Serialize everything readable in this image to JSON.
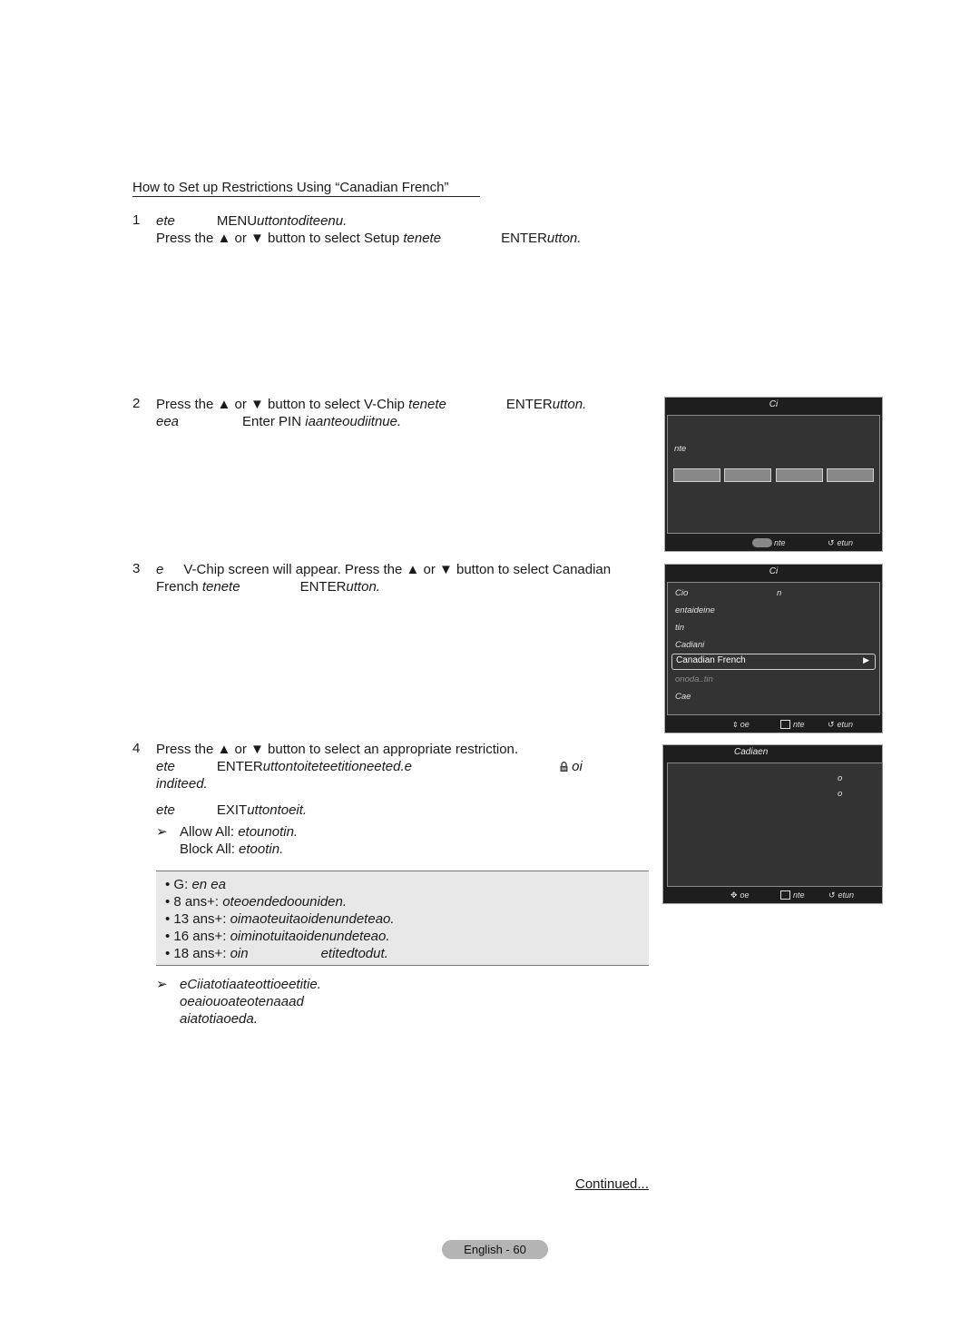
{
  "section": {
    "title": "How to Set up Restrictions Using “Canadian French”"
  },
  "steps": [
    {
      "number": "1",
      "lines": [
        {
          "a": "ete",
          "b": "MENU",
          "c": "uttontoditeenu."
        },
        {
          "a": "Press the ▲ or ▼ button to select Setup",
          "b": "tenete",
          "c": "ENTER",
          "d": "utton."
        }
      ]
    },
    {
      "number": "2",
      "lines": [
        {
          "a": "Press the ▲ or ▼ button to select V-Chip",
          "b": "tenete",
          "c": "ENTER",
          "d": "utton."
        },
        {
          "a": "eea",
          "b": "Enter PIN",
          "c": "iaanteoudiitnue."
        }
      ]
    },
    {
      "number": "3",
      "lines": [
        {
          "a": "e",
          "b": "V-Chip  screen will appear. Press the ▲ or ▼ button to select Canadian"
        },
        {
          "a": "French",
          "b": "tenete",
          "c": "ENTER",
          "d": "utton."
        }
      ]
    },
    {
      "number": "4",
      "lines": [
        {
          "a": "Press the ▲ or ▼ button to select an appropriate restriction."
        },
        {
          "a": "ete",
          "b": "ENTER",
          "c": "uttontoiteteetitioneeted.e",
          "d": "oi"
        },
        {
          "a": "inditeed."
        },
        {
          "a": "ete",
          "b": "EXIT",
          "c": "uttontoeit."
        }
      ],
      "tips": [
        {
          "label": "Allow All:",
          "text": "etounotin."
        },
        {
          "label": "Block All:",
          "text": "etootin."
        }
      ]
    }
  ],
  "ratings_box": [
    {
      "label": "• G:",
      "text": "en   ea"
    },
    {
      "label": "• 8 ans+:",
      "text": "oteoendedoouniden."
    },
    {
      "label": "• 13 ans+:",
      "text": "oimaoteuitaoidenundeteao."
    },
    {
      "label": "• 16 ans+:",
      "text": "oiminotuitaoidenundeteao."
    },
    {
      "label": "• 18 ans+:",
      "text": "oin",
      "text2": "etitedtodut."
    }
  ],
  "note": {
    "lines": [
      "eCiiatotiaateottioeetitie.",
      "oeaiouoateotenaaad",
      "aiatotiaoeda."
    ]
  },
  "tv_screens": {
    "pin": {
      "title": "Ci",
      "label": "nte",
      "footer": {
        "enter": "nte",
        "return": "etun"
      }
    },
    "vchip": {
      "title": "Ci",
      "items": [
        {
          "label": "Cio",
          "value": "n"
        },
        {
          "label": "entaideine"
        },
        {
          "label": "tin"
        },
        {
          "label": "Cadiani"
        },
        {
          "label": "Canadian French",
          "selected": true
        },
        {
          "label": "onoda..tin",
          "dimmed": true
        },
        {
          "label": "Cae"
        }
      ],
      "footer": {
        "move": "oe",
        "enter": "nte",
        "return": "etun"
      }
    },
    "canadian_french": {
      "title": "Cadiaen",
      "values": [
        "o",
        "o"
      ],
      "footer": {
        "move": "oe",
        "enter": "nte",
        "return": "etun"
      }
    }
  },
  "continued": "Continued...",
  "page_label": "English - 60"
}
